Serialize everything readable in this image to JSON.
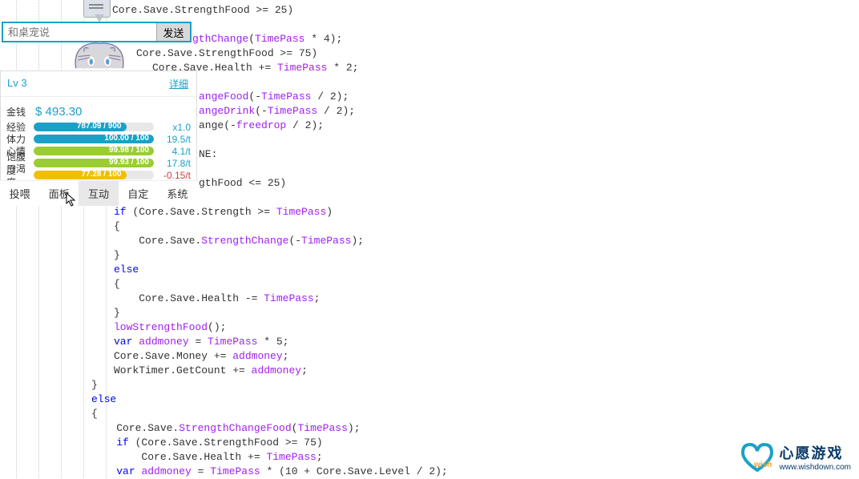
{
  "chat": {
    "placeholder": "和桌宠说",
    "send_label": "发送"
  },
  "stats": {
    "level": "Lv 3",
    "detail_label": "详细",
    "money_label": "金钱",
    "money_value": "$ 493.30",
    "rows": [
      {
        "label": "经验",
        "text": "787.09 / 900",
        "pct": 77,
        "color": "#1ca0c8",
        "rate": "x1.0"
      },
      {
        "label": "体力",
        "text": "100.00 / 100",
        "pct": 100,
        "color": "#1ca0c8",
        "rate": "19.5/t"
      },
      {
        "label": "心情",
        "text": "99.98 / 100",
        "pct": 100,
        "color": "#9acd32",
        "rate": "4.1/t"
      },
      {
        "label": "饱腹度",
        "text": "99.93 / 100",
        "pct": 100,
        "color": "#9acd32",
        "rate": "17.8/t"
      },
      {
        "label": "口渴度",
        "text": "77.28 / 100",
        "pct": 77,
        "color": "#f0c000",
        "rate": "-0.15/t",
        "neg": true
      }
    ]
  },
  "tabs": [
    "投喂",
    "面板",
    "互动",
    "自定",
    "系统"
  ],
  "active_tab": 2,
  "watermark": {
    "title": "心愿游戏",
    "url": "www.wishdown.com"
  },
  "code": {
    "l1": "Core.Save.StrengthFood >= 25)",
    "l3a": "gthChange",
    "l3b": "TimePass",
    "l3c": " * 4);",
    "l4": "Core.Save.StrengthFood >= 75)",
    "l5a": "Core.Save.Health += ",
    "l5b": "TimePass",
    "l5c": " * 2;",
    "l7a": "angeFood",
    "l7b": "TimePass",
    "l7c": " / 2);",
    "l8a": "angeDrink",
    "l8b": "TimePass",
    "l8c": " / 2);",
    "l9a": "ange(-",
    "l9b": "freedrop",
    "l9c": " / 2);",
    "l11": "NE:",
    "l12": "gthFood <= 25)",
    "l14a": "if",
    "l14b": " (Core.Save.Strength >= ",
    "l14c": "TimePass",
    "l14d": ")",
    "l15": "{",
    "l16a": "    Core.Save.",
    "l16b": "StrengthChange",
    "l16c": "(-",
    "l16d": "TimePass",
    "l16e": ");",
    "l17": "}",
    "l18": "else",
    "l19": "{",
    "l20a": "    Core.Save.Health -= ",
    "l20b": "TimePass",
    "l20c": ";",
    "l21": "}",
    "l22a": "lowStrengthFood",
    "l22b": "();",
    "l23a": "var",
    "l23b": "addmoney",
    "l23c": " = ",
    "l23d": "TimePass",
    "l23e": " * 5;",
    "l24a": "Core.Save.Money += ",
    "l24b": "addmoney",
    "l24c": ";",
    "l25a": "WorkTimer.GetCount += ",
    "l25b": "addmoney",
    "l25c": ";",
    "l26": "}",
    "l27": "else",
    "l28": "{",
    "l29a": "    Core.Save.",
    "l29b": "StrengthChangeFood",
    "l29c": "(",
    "l29d": "TimePass",
    "l29e": ");",
    "l30a": "    ",
    "l30b": "if",
    "l30c": " (Core.Save.StrengthFood >= 75)",
    "l31a": "        Core.Save.Health += ",
    "l31b": "TimePass",
    "l31c": ";",
    "l32a": "    ",
    "l32b": "var",
    "l32c": "addmoney",
    "l32d": " = ",
    "l32e": "TimePass",
    "l32f": " * (10 + Core.Save.Level / 2);"
  }
}
